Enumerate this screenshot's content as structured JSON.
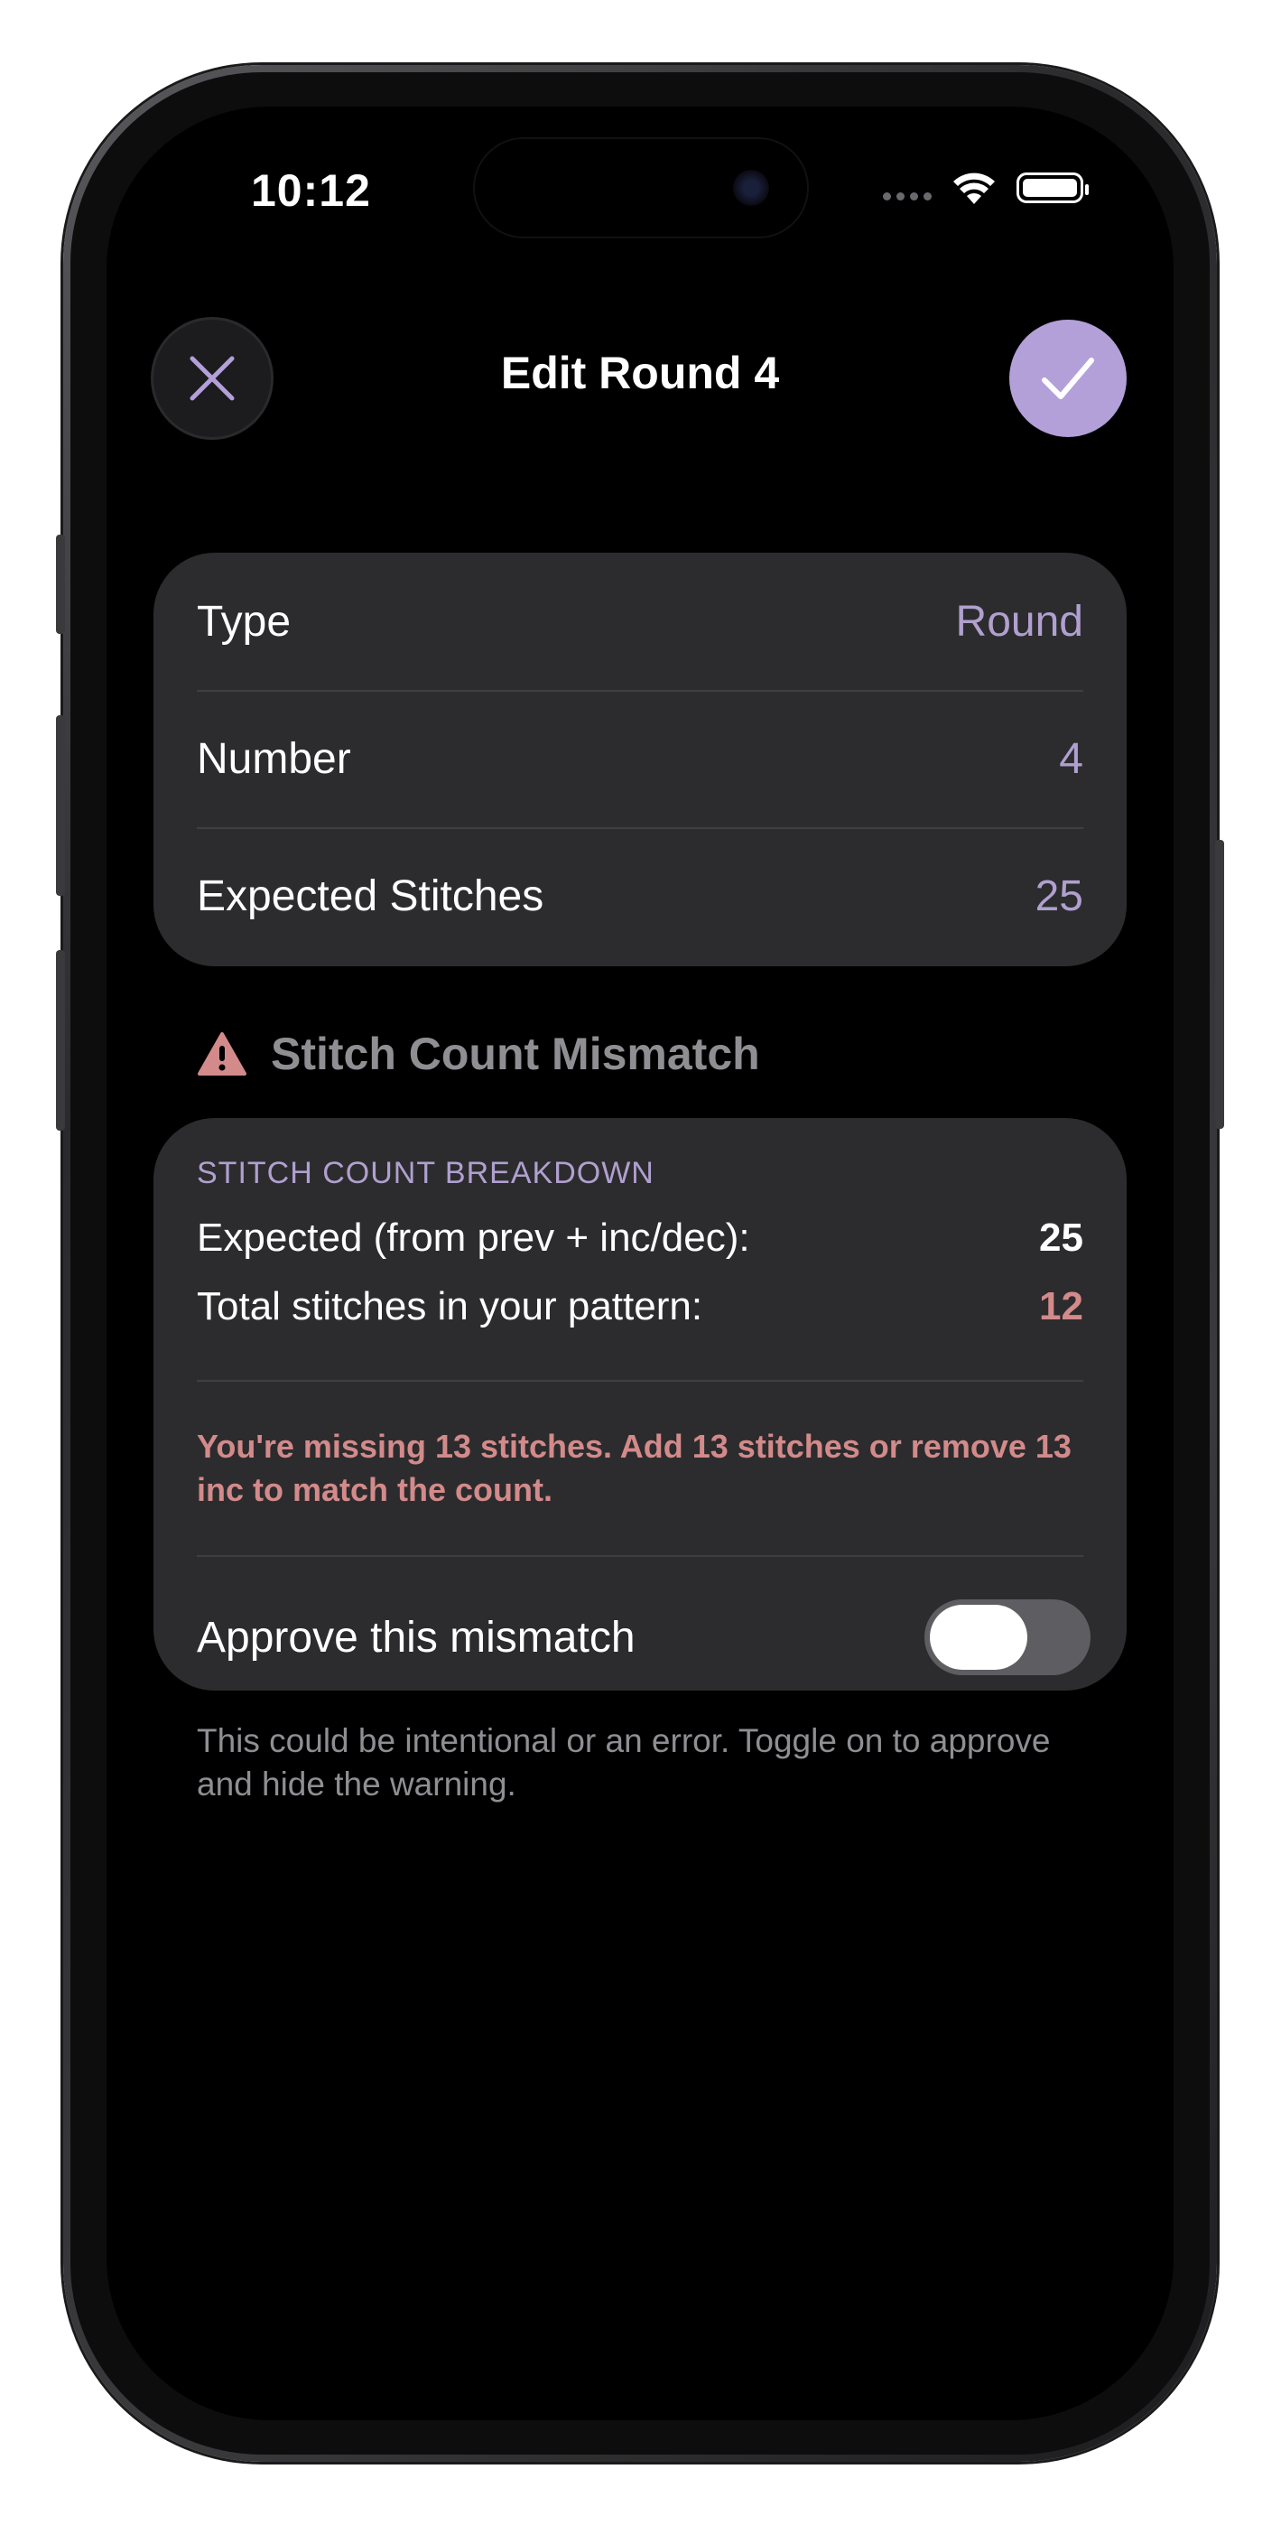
{
  "status_bar": {
    "time": "10:12"
  },
  "nav": {
    "title": "Edit Round 4",
    "close_icon": "close-icon",
    "confirm_icon": "checkmark-icon",
    "accent_color": "#b3a0d9"
  },
  "details": {
    "rows": [
      {
        "label": "Type",
        "value": "Round"
      },
      {
        "label": "Number",
        "value": "4"
      },
      {
        "label": "Expected Stitches",
        "value": "25"
      }
    ]
  },
  "warning": {
    "icon": "warning-triangle-icon",
    "title": "Stitch Count Mismatch",
    "section_caption": "STITCH COUNT BREAKDOWN",
    "expected_label": "Expected (from prev + inc/dec):",
    "expected_value": "25",
    "total_label": "Total stitches in your pattern:",
    "total_value": "12",
    "message": "You're missing 13 stitches. Add 13 stitches or remove 13 inc to match the count.",
    "approve_label": "Approve this mismatch",
    "approve_on": false,
    "error_color": "#d38a8a",
    "footnote": "This could be intentional or an error. Toggle on to approve and hide the warning."
  }
}
